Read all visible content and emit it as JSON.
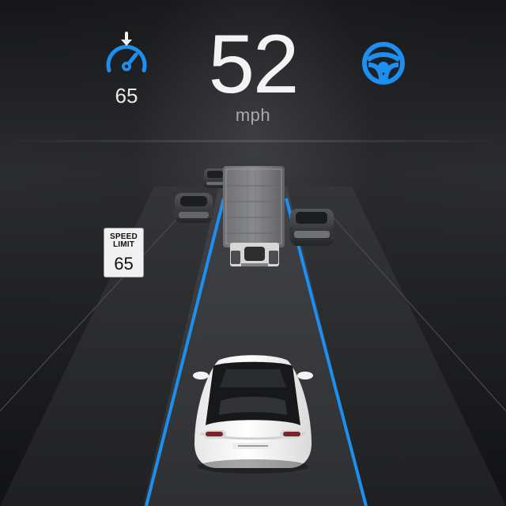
{
  "cluster": {
    "cruise_set_speed": "65",
    "current_speed": "52",
    "speed_unit": "mph",
    "cruise_icon": "cruise-control-icon",
    "autosteer_icon": "steering-wheel-icon",
    "accent_color": "#1d8ff0"
  },
  "road": {
    "speed_limit_sign": {
      "title_line_1": "SPEED",
      "title_line_2": "LIMIT",
      "value": "65"
    },
    "lane_color": "#1d8ff0",
    "vehicles": [
      "lead-truck",
      "left-car-near",
      "left-car-far",
      "right-car",
      "ego-car"
    ]
  }
}
